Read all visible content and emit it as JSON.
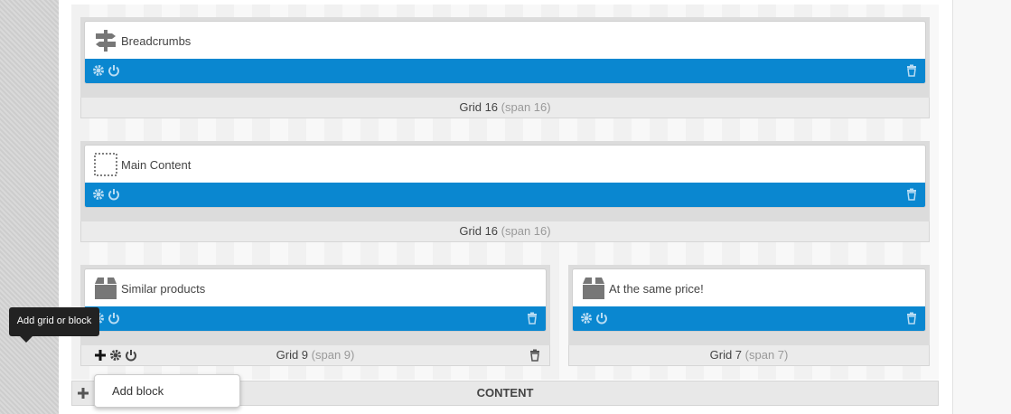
{
  "rows": [
    {
      "block_title": "Breadcrumbs",
      "icon": "signpost-icon",
      "grid_name": "Grid 16",
      "grid_span": "(span 16)"
    },
    {
      "block_title": "Main Content",
      "icon": "dotted-square-icon",
      "grid_name": "Grid 16",
      "grid_span": "(span 16)"
    }
  ],
  "split": [
    {
      "block_title": "Similar products",
      "icon": "box-icon",
      "grid_name": "Grid 9",
      "grid_span": "(span 9)"
    },
    {
      "block_title": "At the same price!",
      "icon": "box-icon",
      "grid_name": "Grid 7",
      "grid_span": "(span 7)"
    }
  ],
  "content_bar": {
    "label": "CONTENT"
  },
  "tooltip": {
    "text": "Add grid or block"
  },
  "menu": {
    "add_block_label": "Add block"
  },
  "colors": {
    "bar_blue": "#0a87d0",
    "tooltip_bg": "#222222"
  }
}
